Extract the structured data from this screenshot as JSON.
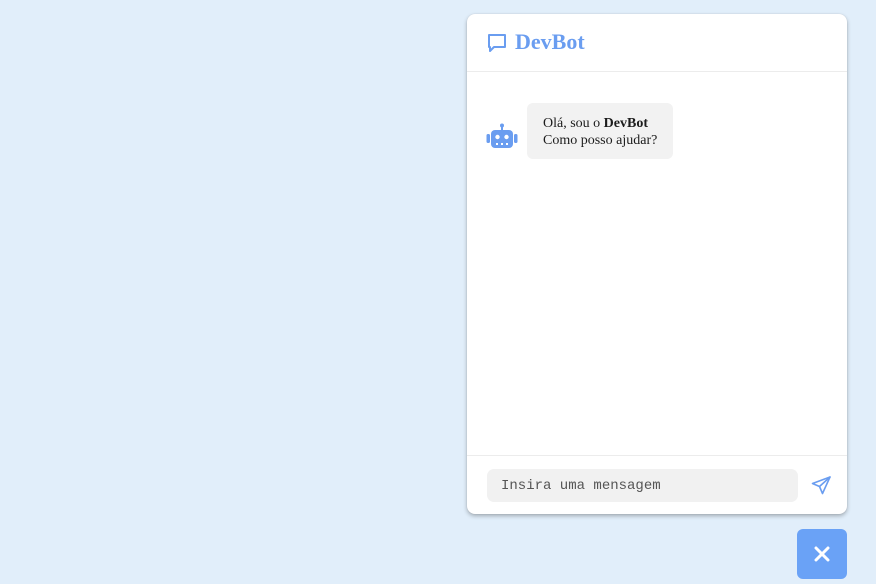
{
  "colors": {
    "background": "#e1eefa",
    "accent": "#6a9df0",
    "fab": "#6aa2f6"
  },
  "header": {
    "title": "DevBot",
    "icon": "chat-bubble-icon"
  },
  "messages": [
    {
      "sender": "bot",
      "avatar_icon": "robot-icon",
      "greeting_prefix": "Olá, sou o ",
      "bot_name": "DevBot",
      "line2": "Como posso ajudar?"
    }
  ],
  "composer": {
    "placeholder": "Insira uma mensagem",
    "value": "",
    "send_icon": "send-icon"
  },
  "toggle": {
    "icon": "close-icon"
  }
}
